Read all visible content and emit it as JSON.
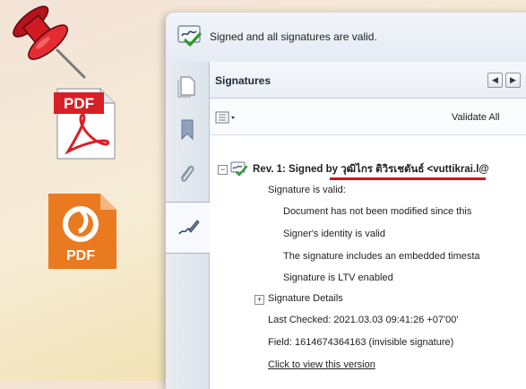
{
  "banner": {
    "text": "Signed and all signatures are valid."
  },
  "signatures_panel": {
    "title": "Signatures",
    "validate_all_label": "Validate All",
    "revision": {
      "title": "Rev. 1: Signed by วุฒิไกร ติวิรเชตันธ์ <vuttikrai.l@",
      "status": "Signature is valid:",
      "details": [
        "Document has not been modified since this",
        "Signer's identity is valid",
        "The signature includes an embedded timesta",
        "Signature is LTV enabled"
      ],
      "signature_details_label": "Signature Details",
      "last_checked": "Last Checked: 2021.03.03 09:41:26 +07'00'",
      "field": "Field: 1614674364163 (invisible signature)",
      "view_version_link": "Click to view this version"
    }
  },
  "icons": {
    "pdf_label_adobe": "PDF",
    "pdf_label_foxit": "PDF"
  },
  "colors": {
    "underline": "#d2141c",
    "adobe_red": "#d71f26",
    "foxit_orange": "#ea7a20"
  }
}
